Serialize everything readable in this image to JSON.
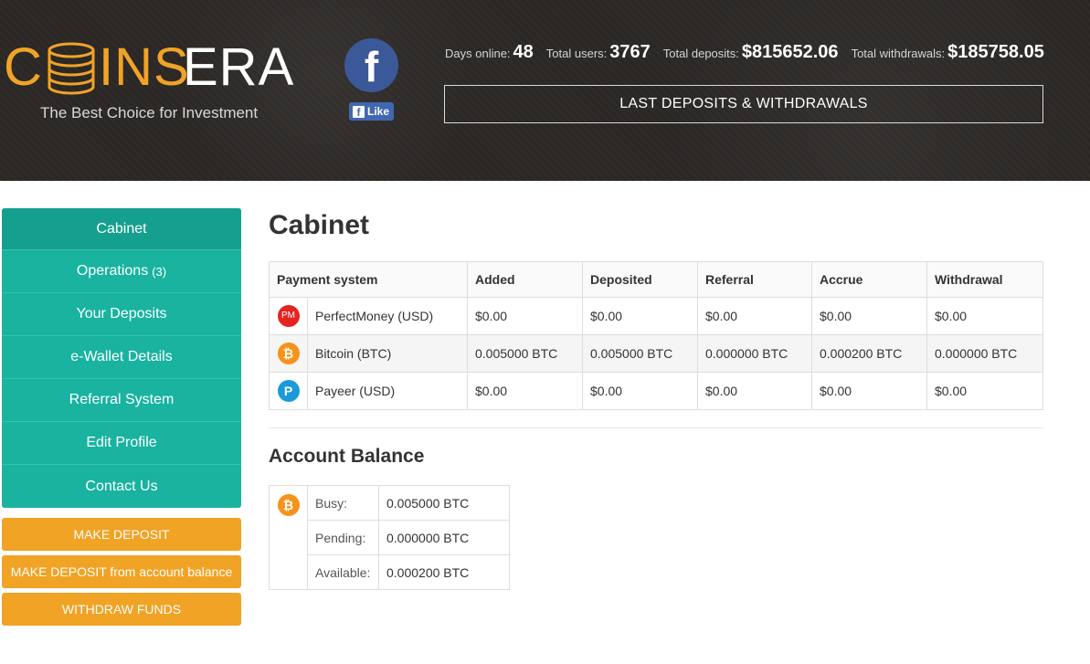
{
  "header": {
    "logo_c": "C",
    "logo_ins": "INS",
    "logo_era": "ERA",
    "tagline": "The Best Choice for Investment",
    "fb_icon_glyph": "f",
    "fb_like_glyph": "f",
    "fb_like_label": "Like",
    "stats": {
      "days_online_label": "Days online:",
      "days_online_value": "48",
      "total_users_label": "Total users:",
      "total_users_value": "3767",
      "total_deposits_label": "Total deposits:",
      "total_deposits_value": "$815652.06",
      "total_withdrawals_label": "Total withdrawals:",
      "total_withdrawals_value": "$185758.05"
    },
    "last_button_label": "LAST DEPOSITS & WITHDRAWALS"
  },
  "sidebar": {
    "items": [
      {
        "label": "Cabinet"
      },
      {
        "label": "Operations",
        "count": "(3)"
      },
      {
        "label": "Your Deposits"
      },
      {
        "label": "e-Wallet Details"
      },
      {
        "label": "Referral System"
      },
      {
        "label": "Edit Profile"
      },
      {
        "label": "Contact Us"
      }
    ],
    "buttons": {
      "make_deposit": "MAKE DEPOSIT",
      "make_deposit_balance": "MAKE DEPOSIT from account balance",
      "withdraw": "WITHDRAW FUNDS"
    }
  },
  "main": {
    "title": "Cabinet",
    "table": {
      "headers": [
        "Payment system",
        "Added",
        "Deposited",
        "Referral",
        "Accrue",
        "Withdrawal"
      ],
      "rows": [
        {
          "icon": "perfectmoney-icon",
          "icon_text": "PM",
          "name": "PerfectMoney (USD)",
          "added": "$0.00",
          "deposited": "$0.00",
          "referral": "$0.00",
          "accrue": "$0.00",
          "withdrawal": "$0.00"
        },
        {
          "icon": "bitcoin-icon",
          "icon_text": "₿",
          "name": "Bitcoin (BTC)",
          "added": "0.005000 BTC",
          "deposited": "0.005000 BTC",
          "referral": "0.000000 BTC",
          "accrue": "0.000200 BTC",
          "withdrawal": "0.000000 BTC"
        },
        {
          "icon": "payeer-icon",
          "icon_text": "P",
          "name": "Payeer (USD)",
          "added": "$0.00",
          "deposited": "$0.00",
          "referral": "$0.00",
          "accrue": "$0.00",
          "withdrawal": "$0.00"
        }
      ]
    },
    "balance": {
      "title": "Account Balance",
      "icon_text": "₿",
      "busy_label": "Busy:",
      "busy_value": "0.005000 BTC",
      "pending_label": "Pending:",
      "pending_value": "0.000000 BTC",
      "available_label": "Available:",
      "available_value": "0.000200 BTC"
    }
  },
  "colors": {
    "accent_orange": "#f0a325",
    "teal": "#19b3a0",
    "header_bg": "#2c2927",
    "pending": "#e8a33c",
    "available": "#1f9e6e"
  }
}
